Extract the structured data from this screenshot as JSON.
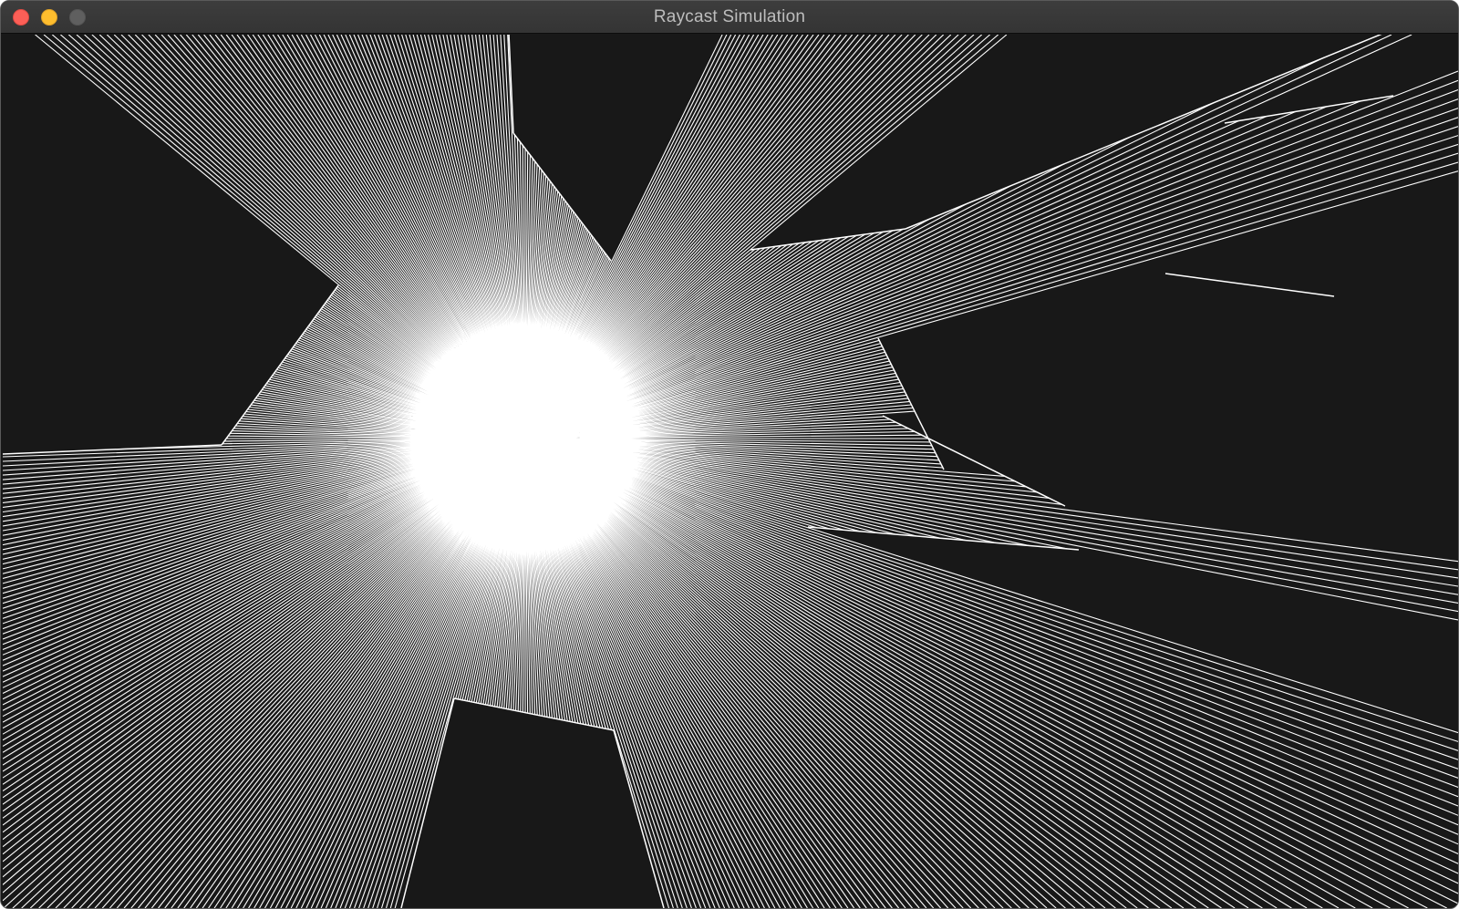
{
  "window": {
    "title": "Raycast Simulation",
    "controls": {
      "close_color": "#fc5f57",
      "minimize_color": "#fdbd2e",
      "zoom_color": "#5f5f5f"
    }
  },
  "canvas": {
    "background": "#181818",
    "ray_color": "#ffffff",
    "wall_color": "#ffffff"
  }
}
